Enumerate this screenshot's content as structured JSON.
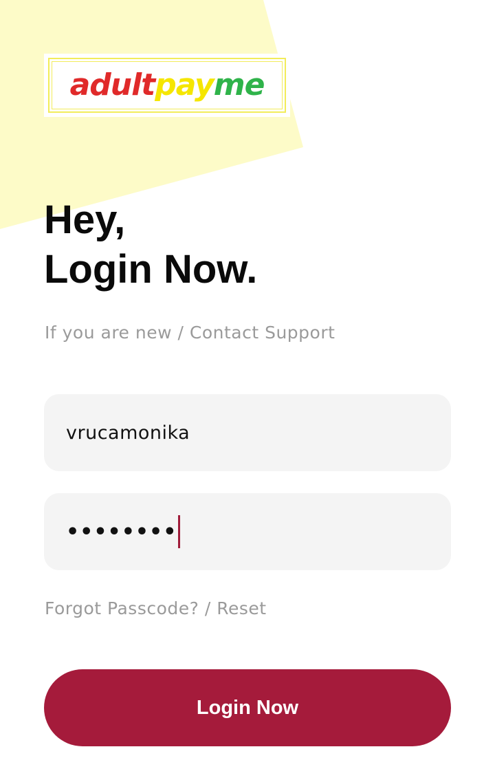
{
  "colors": {
    "background_shape": "#fdfbc8",
    "accent": "#a51b3b",
    "field_bg": "#f4f4f4",
    "muted_text": "#9a9a9a",
    "logo_red": "#e02a2a",
    "logo_yellow": "#f5e600",
    "logo_green": "#2fb34a"
  },
  "logo": {
    "part1": "adult",
    "part2": "pay",
    "part3": "me"
  },
  "heading": {
    "line1": "Hey,",
    "line2": "Login Now."
  },
  "contact_link": "If you are new / Contact Support",
  "form": {
    "username_value": "vrucamonika",
    "password_value": "••••••••"
  },
  "forgot_link": "Forgot Passcode? / Reset",
  "login_button": "Login Now"
}
